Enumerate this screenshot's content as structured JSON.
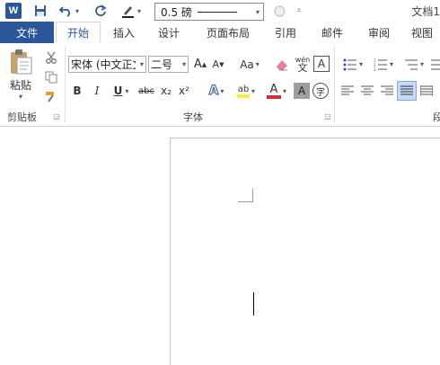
{
  "app": {
    "logo_letter": "W",
    "doc_title": "文档1"
  },
  "quick_access": {
    "line_weight": "0.5 磅"
  },
  "tabs": {
    "file": "文件",
    "items": [
      {
        "label": "开始",
        "active": true
      },
      {
        "label": "插入"
      },
      {
        "label": "设计"
      },
      {
        "label": "页面布局"
      },
      {
        "label": "引用"
      },
      {
        "label": "邮件"
      },
      {
        "label": "审阅"
      },
      {
        "label": "视图"
      }
    ]
  },
  "clipboard": {
    "paste_label": "粘贴",
    "group_label": "剪贴板"
  },
  "font": {
    "name": "宋体 (中文正文)",
    "size": "二号",
    "group_label": "字体",
    "change_case": "Aa",
    "phonetic_top": "wén",
    "phonetic_bottom": "文",
    "char_border": "A",
    "bold": "B",
    "italic": "I",
    "underline": "U",
    "strikethrough": "abc",
    "subscript": "x₂",
    "superscript": "x²",
    "effects": "A",
    "highlight": "ab",
    "font_color": "A",
    "char_shading": "A",
    "enclose": "字",
    "grow": "A",
    "shrink": "A"
  },
  "paragraph": {
    "group_label": "段"
  },
  "colors": {
    "accent": "#2b579a",
    "font_color": "#d32f2f",
    "highlight": "#ffeb3b"
  }
}
